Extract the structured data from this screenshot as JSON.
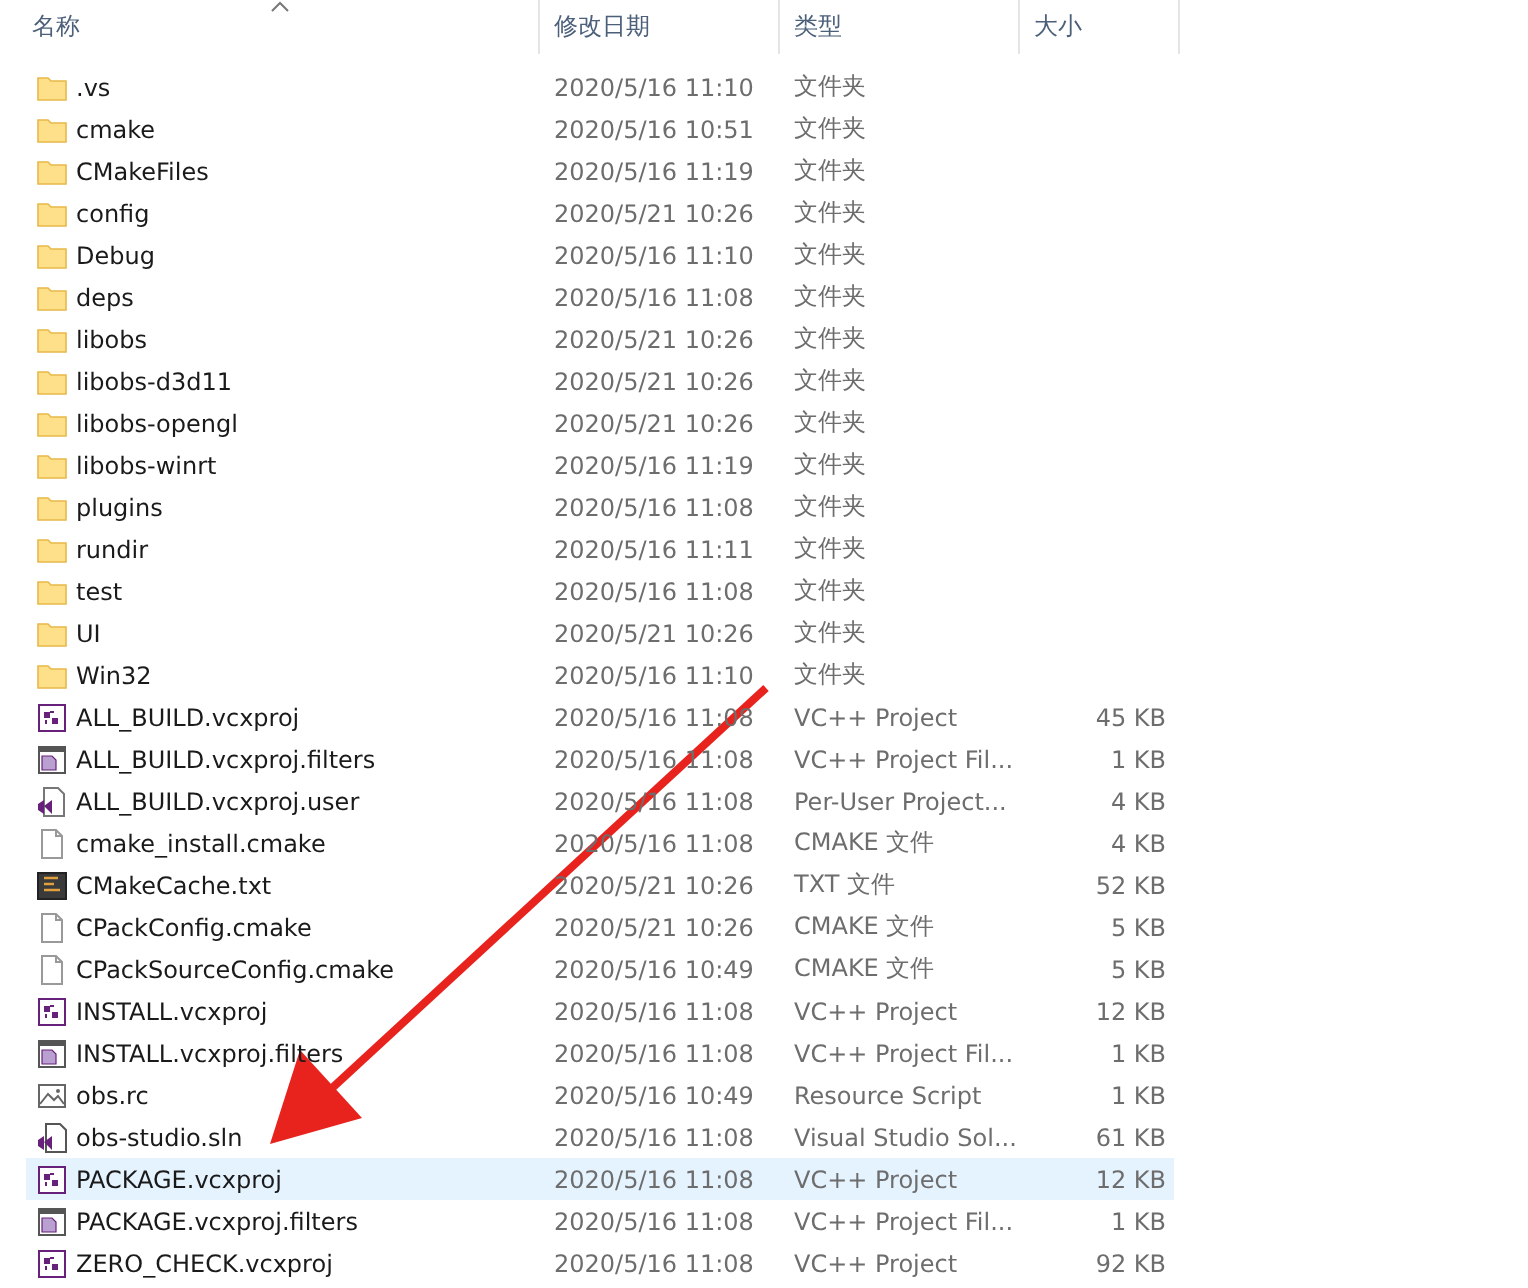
{
  "columns": [
    {
      "label": "名称",
      "sorted": true
    },
    {
      "label": "修改日期",
      "sorted": false
    },
    {
      "label": "类型",
      "sorted": false
    },
    {
      "label": "大小",
      "sorted": false
    }
  ],
  "files": [
    {
      "name": ".vs",
      "date": "2020/5/16 11:10",
      "type": "文件夹",
      "kind": "folder",
      "selected": false
    },
    {
      "name": "cmake",
      "date": "2020/5/16 10:51",
      "type": "文件夹",
      "kind": "folder",
      "selected": false
    },
    {
      "name": "CMakeFiles",
      "date": "2020/5/16 11:19",
      "type": "文件夹",
      "kind": "folder",
      "selected": false
    },
    {
      "name": "config",
      "date": "2020/5/21 10:26",
      "type": "文件夹",
      "kind": "folder",
      "selected": false
    },
    {
      "name": "Debug",
      "date": "2020/5/16 11:10",
      "type": "文件夹",
      "kind": "folder",
      "selected": false
    },
    {
      "name": "deps",
      "date": "2020/5/16 11:08",
      "type": "文件夹",
      "kind": "folder",
      "selected": false
    },
    {
      "name": "libobs",
      "date": "2020/5/21 10:26",
      "type": "文件夹",
      "kind": "folder",
      "selected": false
    },
    {
      "name": "libobs-d3d11",
      "date": "2020/5/21 10:26",
      "type": "文件夹",
      "kind": "folder",
      "selected": false
    },
    {
      "name": "libobs-opengl",
      "date": "2020/5/21 10:26",
      "type": "文件夹",
      "kind": "folder",
      "selected": false
    },
    {
      "name": "libobs-winrt",
      "date": "2020/5/16 11:19",
      "type": "文件夹",
      "kind": "folder",
      "selected": false
    },
    {
      "name": "plugins",
      "date": "2020/5/16 11:08",
      "type": "文件夹",
      "kind": "folder",
      "selected": false
    },
    {
      "name": "rundir",
      "date": "2020/5/16 11:11",
      "type": "文件夹",
      "kind": "folder",
      "selected": false
    },
    {
      "name": "test",
      "date": "2020/5/16 11:08",
      "type": "文件夹",
      "kind": "folder",
      "selected": false
    },
    {
      "name": "UI",
      "date": "2020/5/21 10:26",
      "type": "文件夹",
      "kind": "folder",
      "selected": false
    },
    {
      "name": "Win32",
      "date": "2020/5/16 11:10",
      "type": "文件夹",
      "kind": "folder",
      "selected": false
    },
    {
      "name": "ALL_BUILD.vcxproj",
      "date": "2020/5/16 11:08",
      "type": "VC++ Project",
      "size": "45 KB",
      "kind": "project",
      "selected": false
    },
    {
      "name": "ALL_BUILD.vcxproj.filters",
      "date": "2020/5/16 11:08",
      "type": "VC++ Project Fil...",
      "size": "1 KB",
      "kind": "filters",
      "selected": false
    },
    {
      "name": "ALL_BUILD.vcxproj.user",
      "date": "2020/5/16 11:08",
      "type": "Per-User Project...",
      "size": "4 KB",
      "kind": "user",
      "selected": false
    },
    {
      "name": "cmake_install.cmake",
      "date": "2020/5/16 11:08",
      "type": "CMAKE 文件",
      "size": "4 KB",
      "kind": "file",
      "selected": false
    },
    {
      "name": "CMakeCache.txt",
      "date": "2020/5/21 10:26",
      "type": "TXT 文件",
      "size": "52 KB",
      "kind": "text",
      "selected": false
    },
    {
      "name": "CPackConfig.cmake",
      "date": "2020/5/21 10:26",
      "type": "CMAKE 文件",
      "size": "5 KB",
      "kind": "file",
      "selected": false
    },
    {
      "name": "CPackSourceConfig.cmake",
      "date": "2020/5/16 10:49",
      "type": "CMAKE 文件",
      "size": "5 KB",
      "kind": "file",
      "selected": false
    },
    {
      "name": "INSTALL.vcxproj",
      "date": "2020/5/16 11:08",
      "type": "VC++ Project",
      "size": "12 KB",
      "kind": "project",
      "selected": false
    },
    {
      "name": "INSTALL.vcxproj.filters",
      "date": "2020/5/16 11:08",
      "type": "VC++ Project Fil...",
      "size": "1 KB",
      "kind": "filters",
      "selected": false
    },
    {
      "name": "obs.rc",
      "date": "2020/5/16 10:49",
      "type": "Resource Script",
      "size": "1 KB",
      "kind": "image",
      "selected": false
    },
    {
      "name": "obs-studio.sln",
      "date": "2020/5/16 11:08",
      "type": "Visual Studio Sol...",
      "size": "61 KB",
      "kind": "solution",
      "selected": false
    },
    {
      "name": "PACKAGE.vcxproj",
      "date": "2020/5/16 11:08",
      "type": "VC++ Project",
      "size": "12 KB",
      "kind": "project",
      "selected": true
    },
    {
      "name": "PACKAGE.vcxproj.filters",
      "date": "2020/5/16 11:08",
      "type": "VC++ Project Fil...",
      "size": "1 KB",
      "kind": "filters",
      "selected": false
    },
    {
      "name": "ZERO_CHECK.vcxproj",
      "date": "2020/5/16 11:08",
      "type": "VC++ Project",
      "size": "92 KB",
      "kind": "project",
      "selected": false
    }
  ]
}
